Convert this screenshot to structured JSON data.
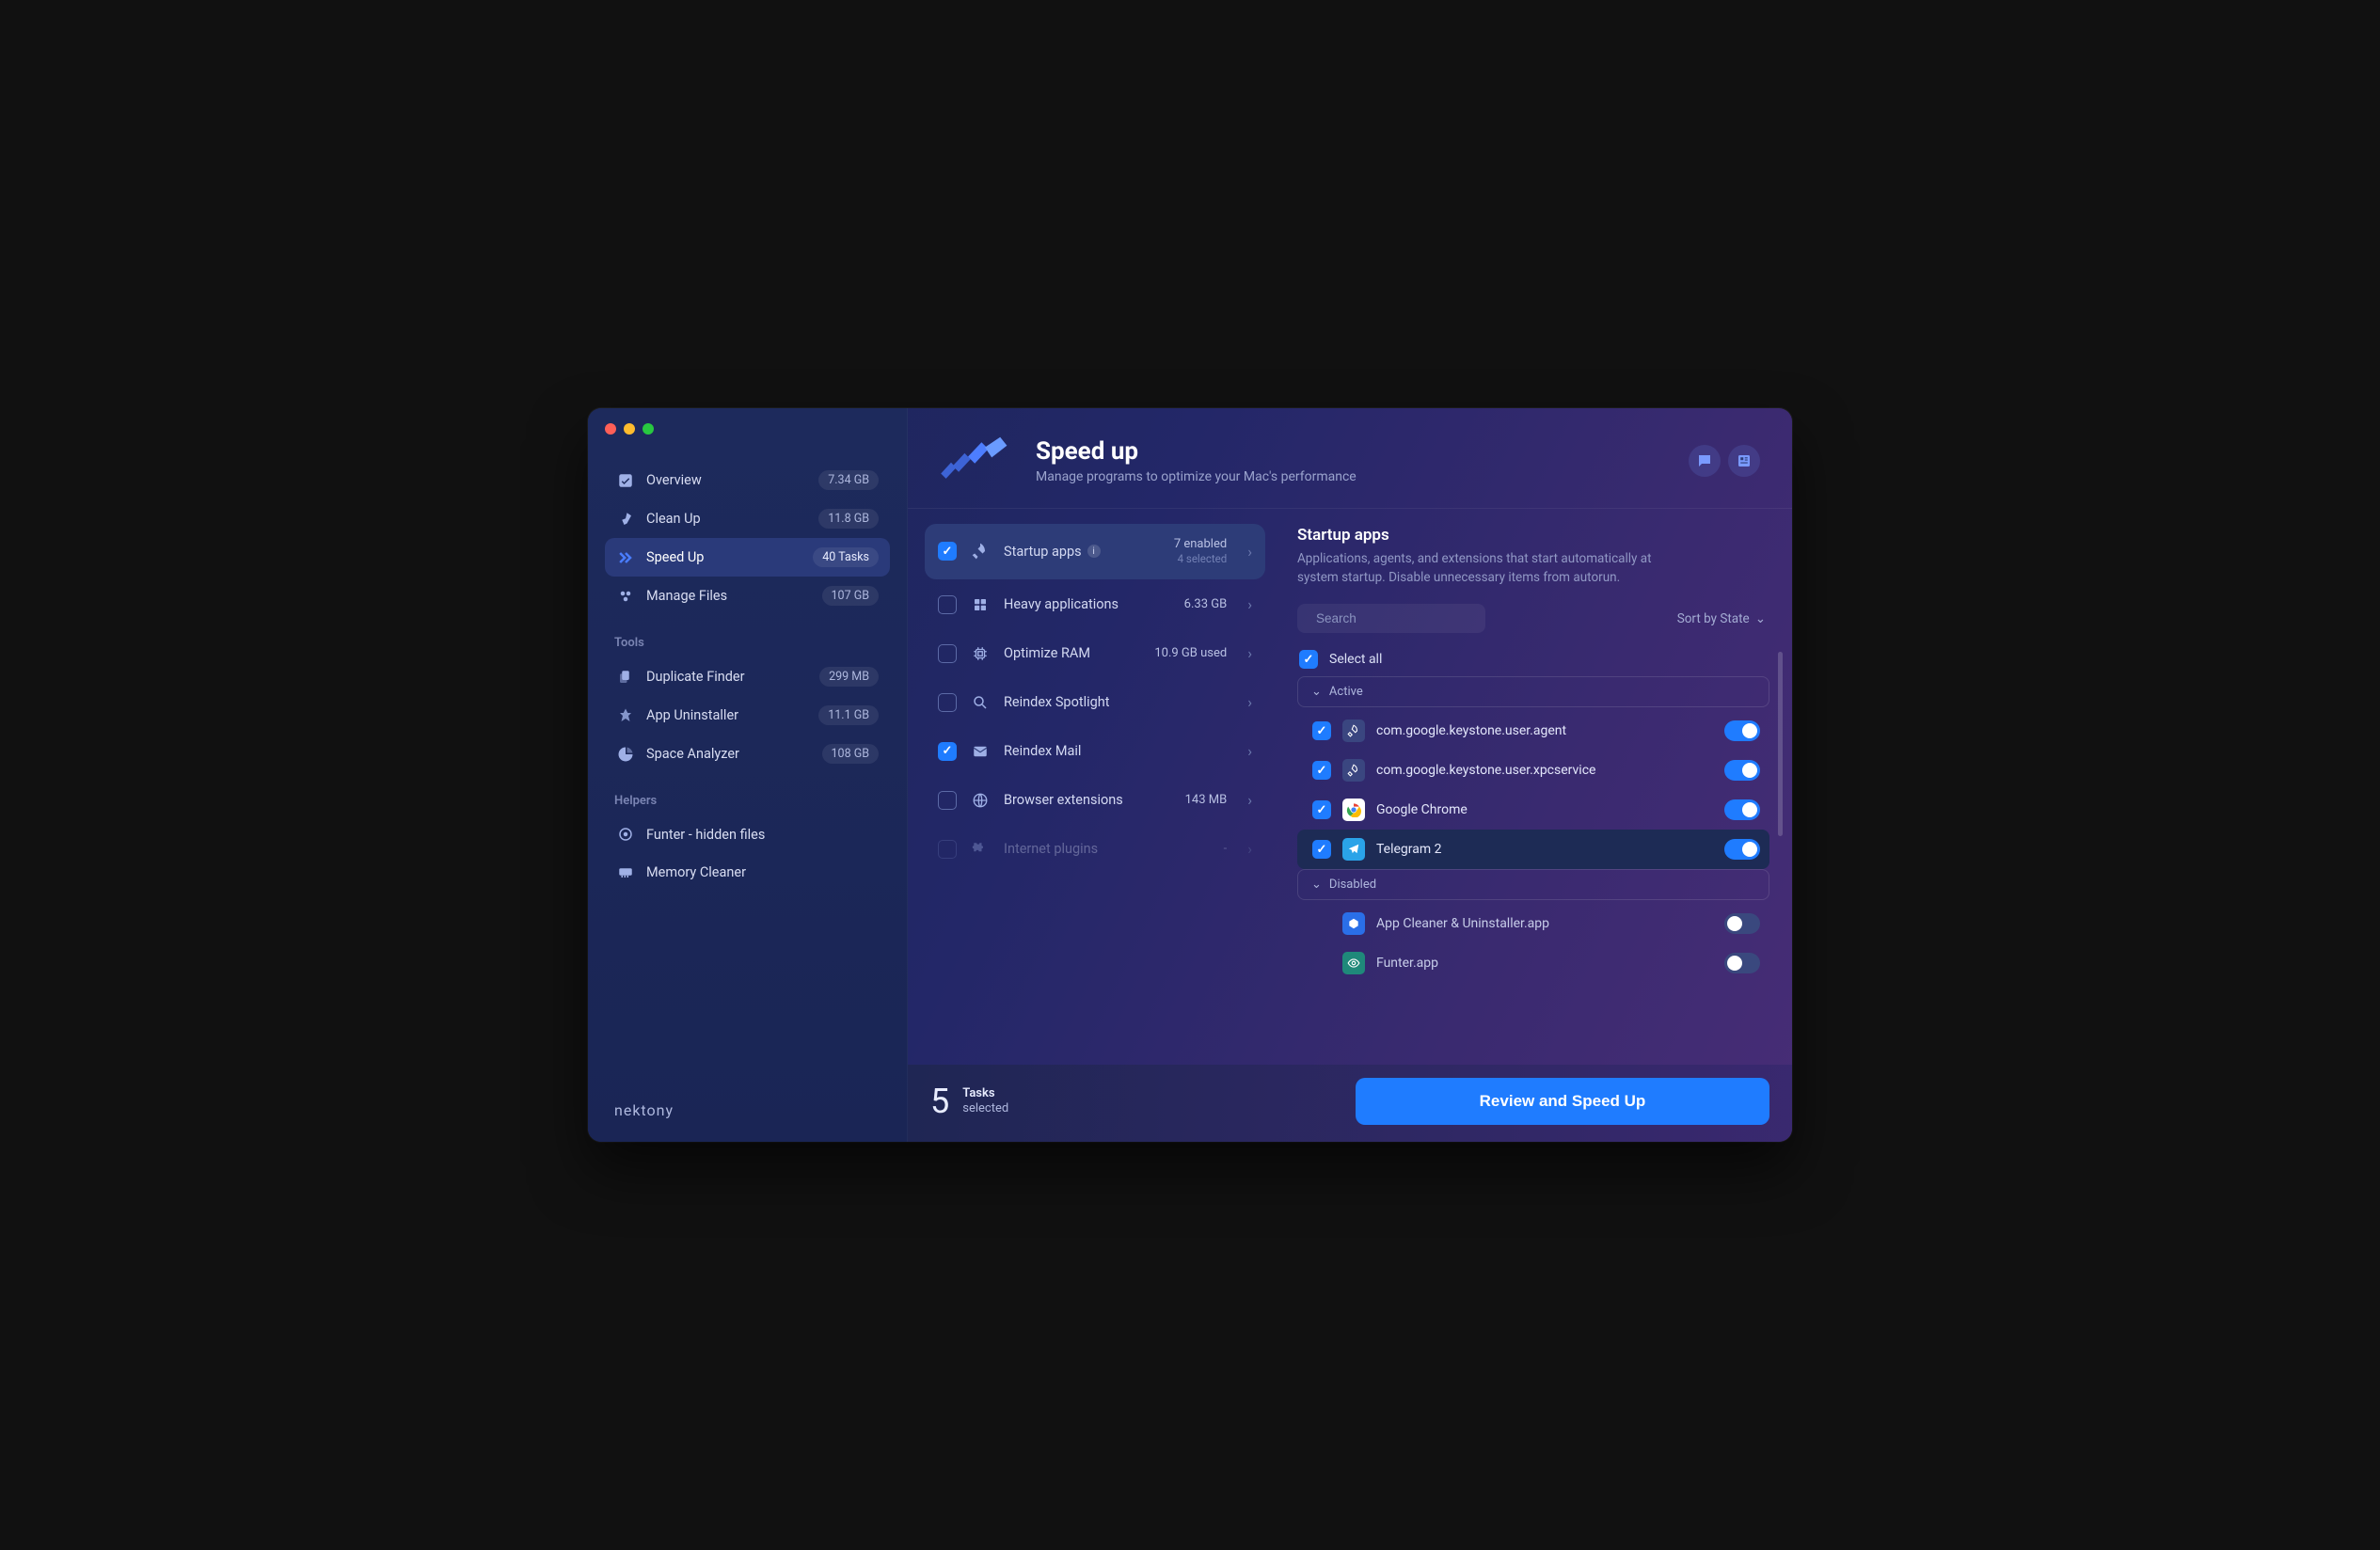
{
  "brand": "nektony",
  "header": {
    "title": "Speed up",
    "subtitle": "Manage programs to optimize your Mac's performance"
  },
  "sidebar": {
    "main": [
      {
        "label": "Overview",
        "badge": "7.34 GB",
        "active": false
      },
      {
        "label": "Clean Up",
        "badge": "11.8 GB",
        "active": false
      },
      {
        "label": "Speed Up",
        "badge": "40 Tasks",
        "active": true
      },
      {
        "label": "Manage Files",
        "badge": "107 GB",
        "active": false
      }
    ],
    "tools_title": "Tools",
    "tools": [
      {
        "label": "Duplicate Finder",
        "badge": "299 MB"
      },
      {
        "label": "App Uninstaller",
        "badge": "11.1 GB"
      },
      {
        "label": "Space Analyzer",
        "badge": "108 GB"
      }
    ],
    "helpers_title": "Helpers",
    "helpers": [
      {
        "label": "Funter - hidden files"
      },
      {
        "label": "Memory Cleaner"
      }
    ]
  },
  "tasks": [
    {
      "label": "Startup apps",
      "value": "7 enabled",
      "sub": "4 selected",
      "checked": true,
      "active": true,
      "info": true
    },
    {
      "label": "Heavy applications",
      "value": "6.33 GB",
      "checked": false
    },
    {
      "label": "Optimize RAM",
      "value": "10.9 GB used",
      "checked": false
    },
    {
      "label": "Reindex Spotlight",
      "value": "",
      "checked": false
    },
    {
      "label": "Reindex Mail",
      "value": "",
      "checked": true
    },
    {
      "label": "Browser extensions",
      "value": "143 MB",
      "checked": false
    },
    {
      "label": "Internet plugins",
      "value": "-",
      "checked": false,
      "disabled": true
    }
  ],
  "details": {
    "title": "Startup apps",
    "description": "Applications, agents, and extensions that start automatically at system startup. Disable unnecessary items from autorun.",
    "search_placeholder": "Search",
    "sort_label": "Sort by State",
    "select_all": "Select all",
    "select_all_checked": true,
    "groups": [
      {
        "name": "Active",
        "items": [
          {
            "label": "com.google.keystone.user.agent",
            "checked": true,
            "on": true,
            "icon": "rocket"
          },
          {
            "label": "com.google.keystone.user.xpcservice",
            "checked": true,
            "on": true,
            "icon": "rocket"
          },
          {
            "label": "Google Chrome",
            "checked": true,
            "on": true,
            "icon": "chrome"
          },
          {
            "label": "Telegram 2",
            "checked": true,
            "on": true,
            "icon": "telegram",
            "selected": true
          }
        ]
      },
      {
        "name": "Disabled",
        "items": [
          {
            "label": "App Cleaner & Uninstaller.app",
            "checked": false,
            "on": false,
            "icon": "appcleaner"
          },
          {
            "label": "Funter.app",
            "checked": false,
            "on": false,
            "icon": "funter"
          }
        ]
      }
    ]
  },
  "footer": {
    "count": "5",
    "count_line1": "Tasks",
    "count_line2": "selected",
    "cta": "Review and Speed Up"
  }
}
